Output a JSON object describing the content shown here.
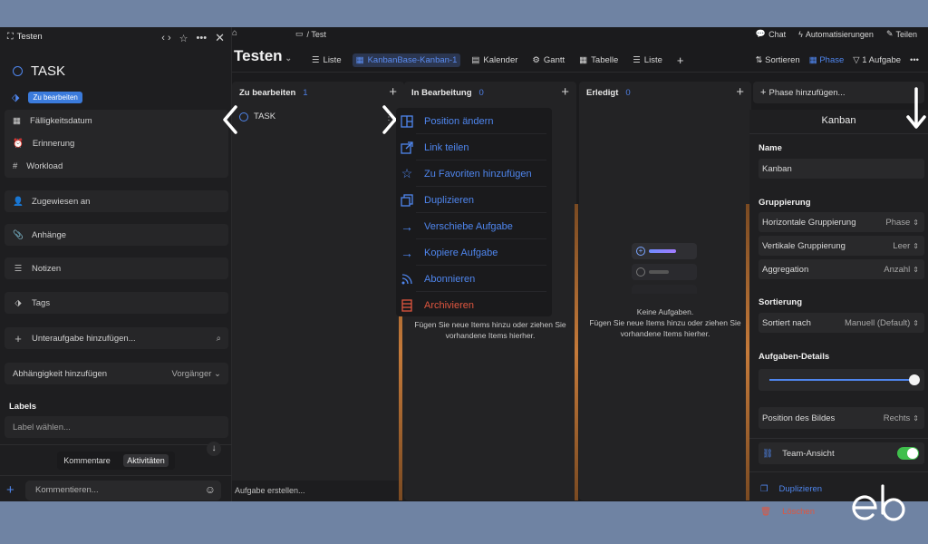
{
  "task_panel": {
    "header_label": "Testen",
    "task_title": "TASK",
    "tag": "Zu bearbeiten",
    "fields": [
      "Fälligkeitsdatum",
      "Erinnerung",
      "Workload"
    ],
    "assigned": "Zugewiesen an",
    "attachments": "Anhänge",
    "notes": "Notizen",
    "tags": "Tags",
    "subtask": "Unteraufgabe hinzufügen...",
    "dependency": "Abhängigkeit hinzufügen",
    "dependency_value": "Vorgänger",
    "labels_heading": "Labels",
    "labels_placeholder": "Label wählen...",
    "tab_comments": "Kommentare",
    "tab_activities": "Aktivitäten",
    "comment_placeholder": "Kommentieren..."
  },
  "topbar": {
    "breadcrumb": "/ Test",
    "chat": "Chat",
    "automations": "Automatisierungen",
    "share": "Teilen"
  },
  "viewbar": {
    "title": "Testen",
    "views": [
      "Liste",
      "KanbanBase-Kanban-1",
      "Kalender",
      "Gantt",
      "Tabelle",
      "Liste"
    ],
    "sort": "Sortieren",
    "phase": "Phase",
    "filter": "1 Aufgabe"
  },
  "columns": [
    {
      "name": "Zu bearbeiten",
      "count": "1",
      "task": "TASK",
      "footer": "Aufgabe erstellen..."
    },
    {
      "name": "In Bearbeitung",
      "count": "0",
      "empty": "Fügen Sie neue Items hinzu oder ziehen Sie vorhandene Items hierher."
    },
    {
      "name": "Erledigt",
      "count": "0",
      "empty_title": "Keine Aufgaben.",
      "empty": "Fügen Sie neue Items hinzu oder ziehen Sie vorhandene Items hierher."
    }
  ],
  "add_phase": "Phase hinzufügen...",
  "context_menu": [
    {
      "label": "Position ändern",
      "icon": "layout-icon"
    },
    {
      "label": "Link teilen",
      "icon": "share-link-icon"
    },
    {
      "label": "Zu Favoriten hinzufügen",
      "icon": "star-icon"
    },
    {
      "label": "Duplizieren",
      "icon": "duplicate-icon"
    },
    {
      "label": "Verschiebe Aufgabe",
      "icon": "arrow-right-icon"
    },
    {
      "label": "Kopiere Aufgabe",
      "icon": "arrow-right-icon"
    },
    {
      "label": "Abonnieren",
      "icon": "rss-icon"
    },
    {
      "label": "Archivieren",
      "icon": "archive-icon"
    }
  ],
  "kanban_panel": {
    "title": "Kanban",
    "name_heading": "Name",
    "name_value": "Kanban",
    "grouping_heading": "Gruppierung",
    "horizontal": "Horizontale Gruppierung",
    "horizontal_value": "Phase",
    "vertical": "Vertikale Gruppierung",
    "vertical_value": "Leer",
    "aggregation": "Aggregation",
    "aggregation_value": "Anzahl",
    "sorting_heading": "Sortierung",
    "sorted_by": "Sortiert nach",
    "sorted_by_value": "Manuell (Default)",
    "details_heading": "Aufgaben-Details",
    "details_slider_value": 1.0,
    "image_position": "Position des Bildes",
    "image_position_value": "Rechts",
    "team_view": "Team-Ansicht",
    "team_view_on": true,
    "duplicate": "Duplizieren",
    "delete": "Löschen"
  },
  "colors": {
    "accent": "#4f86ee",
    "danger": "#e0563f",
    "toggle": "#3fbf4c",
    "background": "#6f83a3"
  }
}
